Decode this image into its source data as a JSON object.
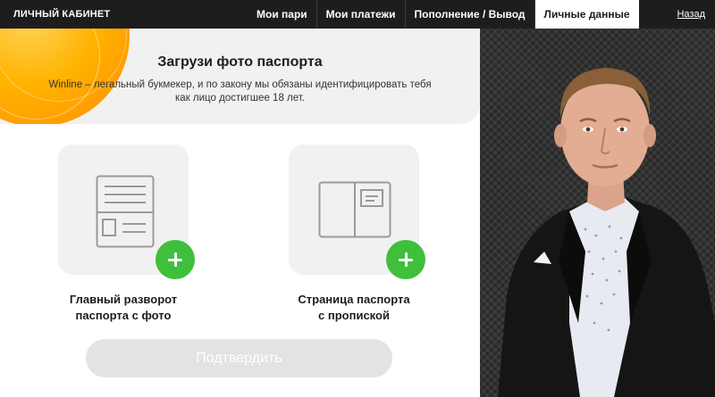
{
  "header": {
    "brand": "ЛИЧНЫЙ КАБИНЕТ",
    "nav": [
      {
        "label": "Мои пари",
        "active": false
      },
      {
        "label": "Мои платежи",
        "active": false
      },
      {
        "label": "Пополнение / Вывод",
        "active": false
      },
      {
        "label": "Личные данные",
        "active": true
      }
    ],
    "back": "Назад"
  },
  "banner": {
    "title": "Загрузи фото паспорта",
    "text": "Winline – легальный букмекер, и по закону мы обязаны идентифицировать тебя как лицо достигшее 18 лет."
  },
  "uploads": [
    {
      "label_line1": "Главный разворот",
      "label_line2": "паспорта с фото",
      "icon": "passport-photo-page-icon"
    },
    {
      "label_line1": "Страница паспорта",
      "label_line2": "с пропиской",
      "icon": "passport-registration-page-icon"
    }
  ],
  "confirm_label": "Подтвердить",
  "colors": {
    "topbar": "#1d1d1d",
    "accent_green": "#3fbf3c",
    "card_bg": "#f1f1f1",
    "button_disabled": "#e3e3e3",
    "orange": "#ffb400"
  }
}
